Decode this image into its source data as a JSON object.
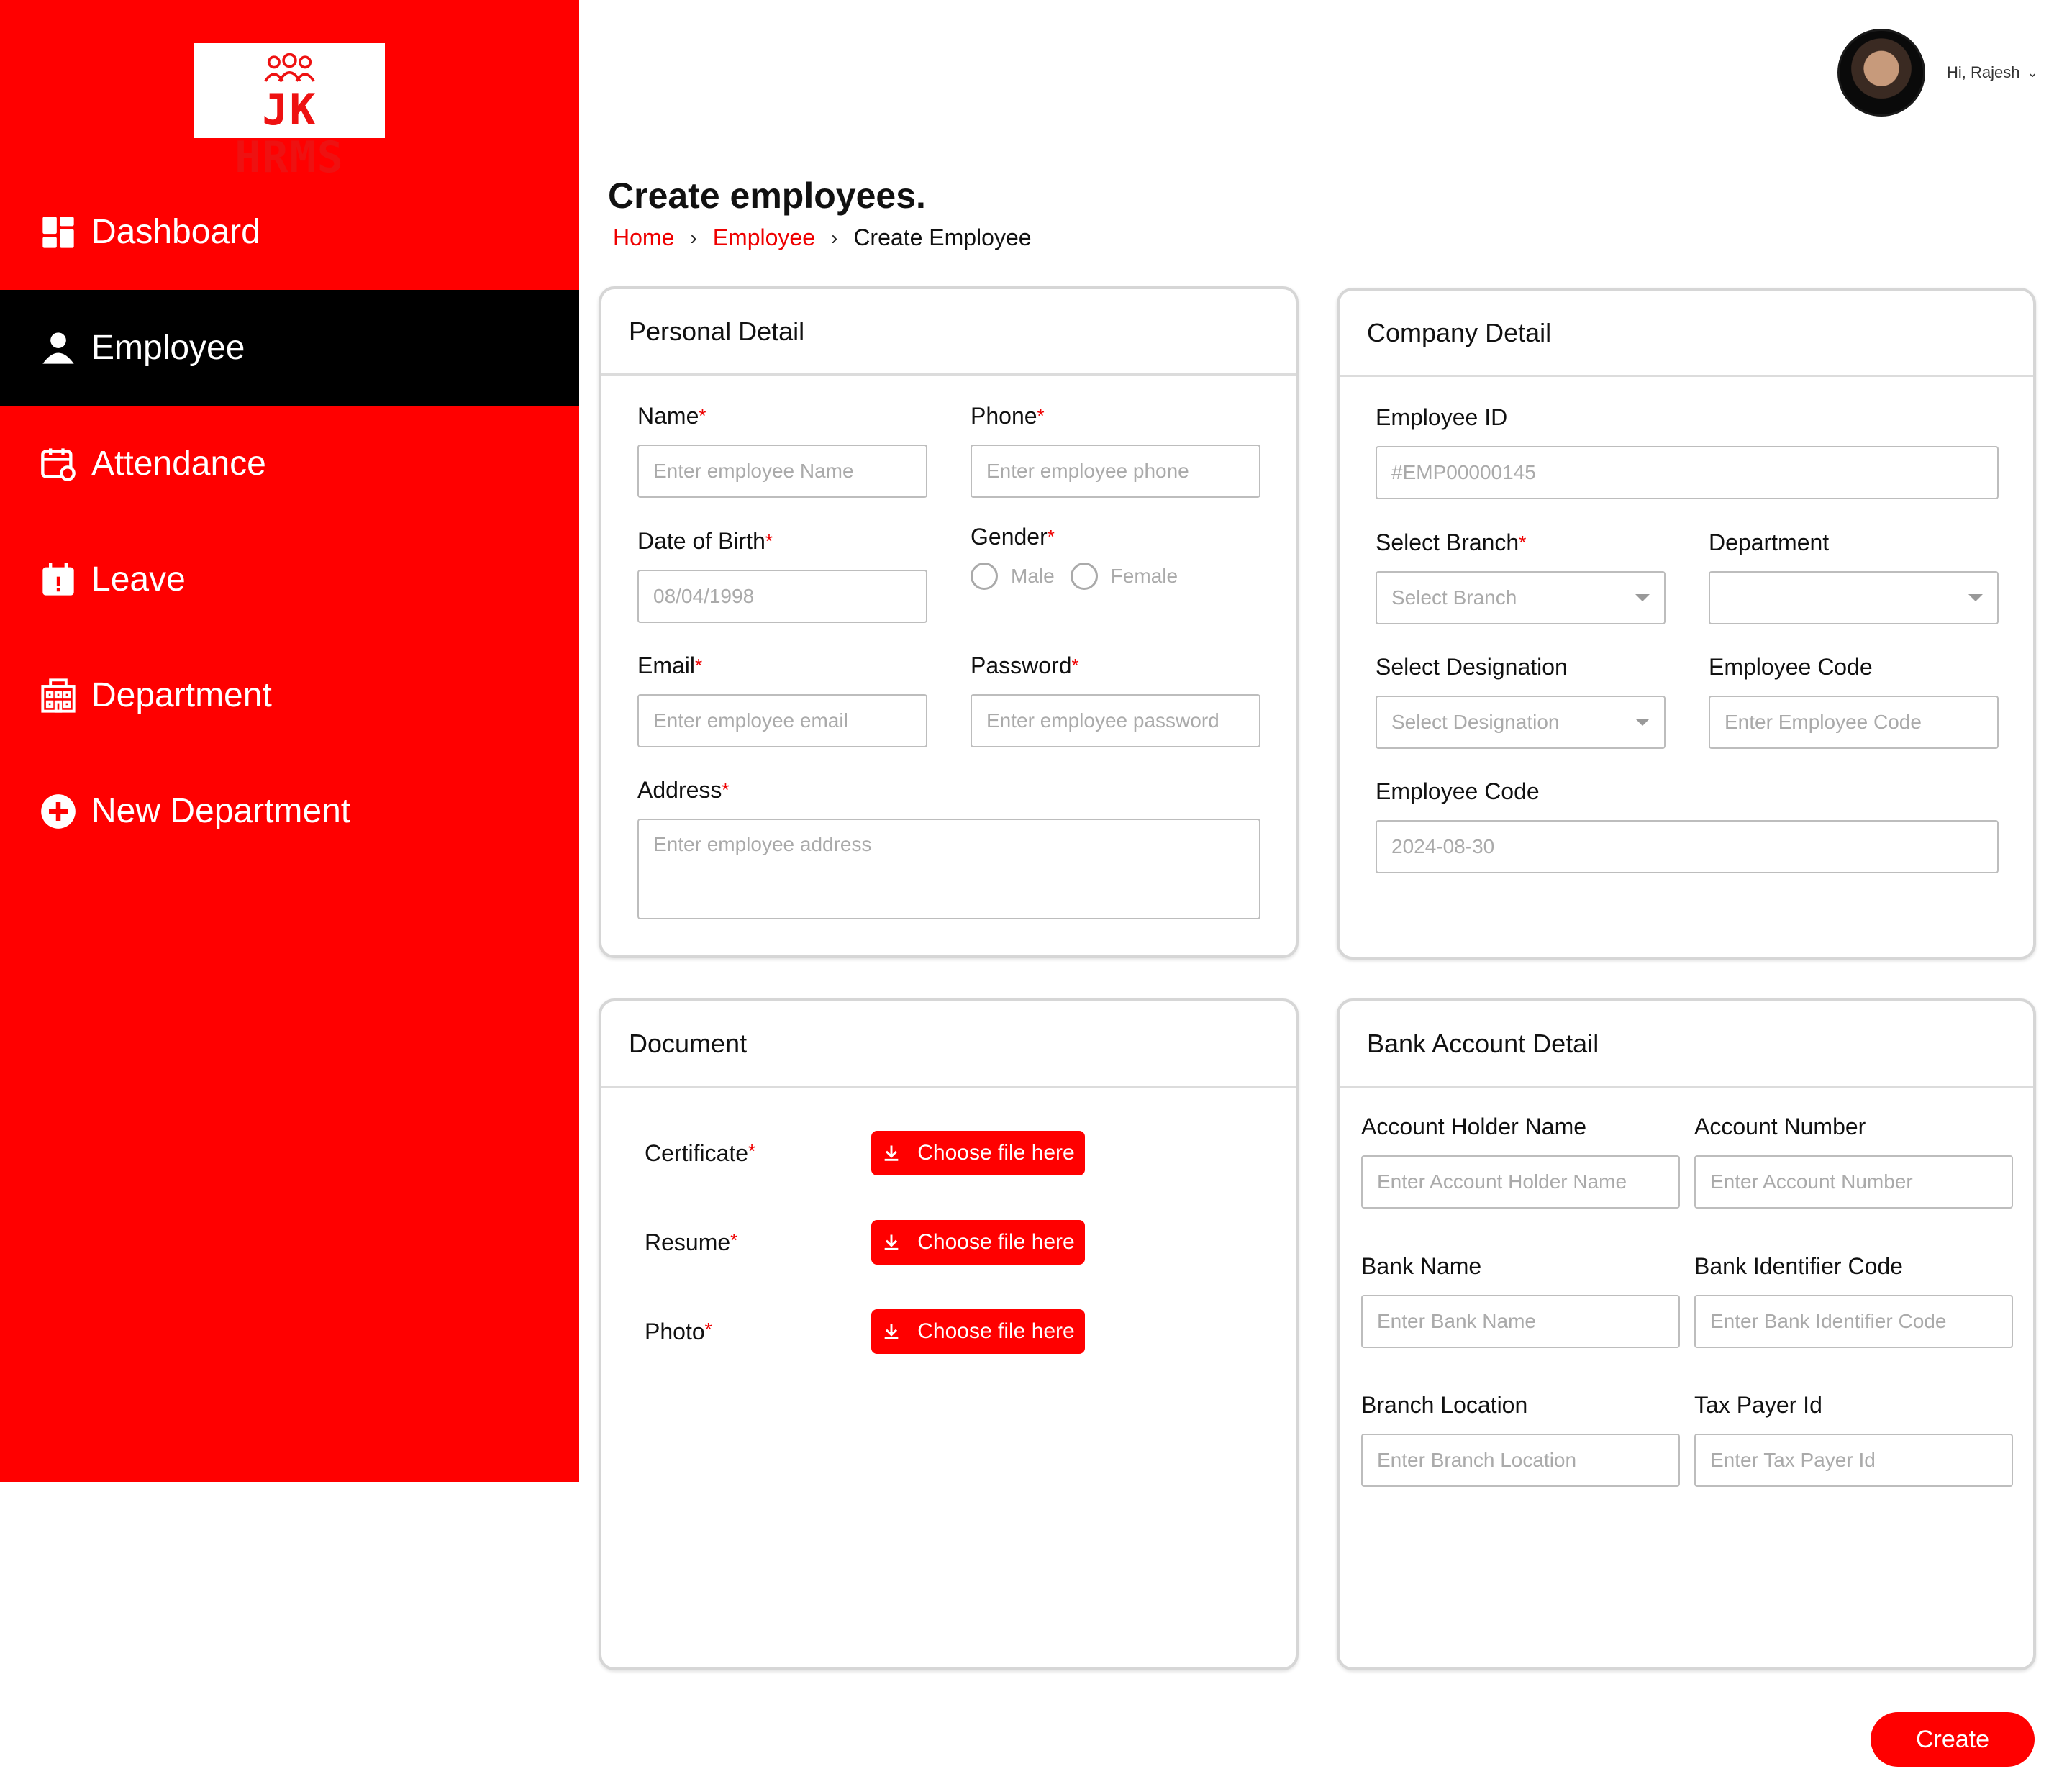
{
  "app": {
    "logo_text": "JK HRMS"
  },
  "sidebar": {
    "items": [
      {
        "label": "Dashboard",
        "icon": "dashboard-icon"
      },
      {
        "label": "Employee",
        "icon": "person-icon",
        "active": true
      },
      {
        "label": "Attendance",
        "icon": "calendar-clock-icon"
      },
      {
        "label": "Leave",
        "icon": "calendar-alert-icon"
      },
      {
        "label": "Department",
        "icon": "building-icon"
      },
      {
        "label": "New Department",
        "icon": "plus-circle-icon"
      }
    ]
  },
  "header": {
    "greeting": "Hi, Rajesh",
    "chevron": "⌄"
  },
  "page": {
    "title": "Create employees."
  },
  "breadcrumb": {
    "home": "Home",
    "employee": "Employee",
    "current": "Create Employee",
    "sep": "›"
  },
  "personal": {
    "title": "Personal Detail",
    "name_label": "Name",
    "name_placeholder": "Enter employee Name",
    "phone_label": "Phone",
    "phone_placeholder": "Enter employee phone",
    "dob_label": "Date of Birth",
    "dob_value": "08/04/1998",
    "gender_label": "Gender",
    "gender_male": "Male",
    "gender_female": "Female",
    "email_label": "Email",
    "email_placeholder": "Enter employee email",
    "password_label": "Password",
    "password_placeholder": "Enter employee password",
    "address_label": "Address",
    "address_placeholder": "Enter employee address"
  },
  "company": {
    "title": "Company Detail",
    "empid_label": "Employee ID",
    "empid_placeholder": "#EMP00000145",
    "branch_label": "Select Branch",
    "branch_value": "Select Branch",
    "dept_label": "Department",
    "dept_value": "",
    "designation_label": "Select Designation",
    "designation_value": "Select Designation",
    "empcode_label": "Employee Code",
    "empcode_placeholder": "Enter Employee Code",
    "empcode2_label": "Employee Code",
    "empcode2_value": "2024-08-30"
  },
  "document": {
    "title": "Document",
    "rows": [
      {
        "label": "Certificate",
        "button": "Choose file here"
      },
      {
        "label": "Resume",
        "button": "Choose file here"
      },
      {
        "label": "Photo",
        "button": "Choose file here"
      }
    ]
  },
  "bank": {
    "title": "Bank Account Detail",
    "holder_label": "Account Holder Name",
    "holder_placeholder": "Enter Account Holder Name",
    "number_label": "Account Number",
    "number_placeholder": "Enter Account Number",
    "bankname_label": "Bank Name",
    "bankname_placeholder": "Enter Bank Name",
    "bic_label": "Bank Identifier Code",
    "bic_placeholder": "Enter Bank Identifier Code",
    "location_label": "Branch Location",
    "location_placeholder": "Enter Branch Location",
    "tax_label": "Tax Payer Id",
    "tax_placeholder": "Enter Tax Payer Id"
  },
  "actions": {
    "create": "Create"
  },
  "colors": {
    "brand": "#ff0000",
    "active_nav": "#000000",
    "required": "#e00000"
  }
}
